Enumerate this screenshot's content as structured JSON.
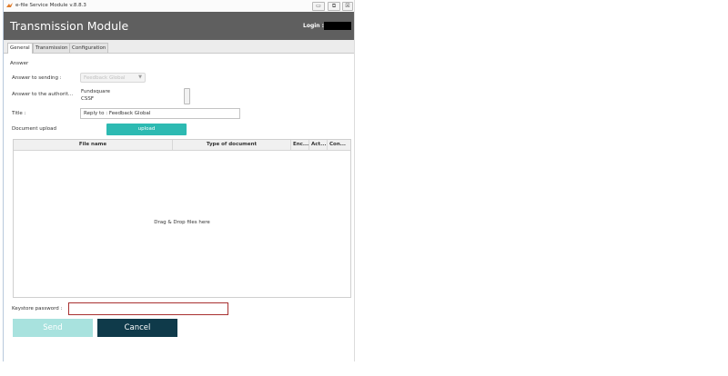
{
  "window": {
    "title": "e-file Service Module v.8.8.3",
    "minimize_glyph": "▭",
    "restore_glyph": "⧉",
    "close_glyph": "☒"
  },
  "header": {
    "title": "Transmission Module",
    "login_label": "Login :"
  },
  "tabs": [
    {
      "label": "General",
      "active": true
    },
    {
      "label": "Transmission",
      "active": false
    },
    {
      "label": "Configuration",
      "active": false
    }
  ],
  "form": {
    "section_title": "Answer",
    "answer_to_sending_label": "Answer to sending :",
    "answer_to_sending_value": "Feedback Global",
    "answer_authorities_label": "Answer to the authorit...",
    "authorities": [
      "Fundsquare",
      "CSSF"
    ],
    "title_label": "Title :",
    "title_value": "Reply to : Feedback Global",
    "upload_label": "Document upload",
    "upload_button": "upload"
  },
  "table": {
    "columns": [
      "File name",
      "Type of document",
      "Enc...",
      "Act...",
      "Con..."
    ],
    "empty_text": "Drag & Drop files here"
  },
  "keystore": {
    "label": "Keystore password :",
    "value": ""
  },
  "actions": {
    "send": "Send",
    "cancel": "Cancel"
  },
  "colors": {
    "header_bg": "#5f5f5f",
    "accent_teal": "#2dbab2",
    "send_disabled": "#a8e2de",
    "cancel_bg": "#0f3a4a",
    "error_border": "#a83030"
  }
}
